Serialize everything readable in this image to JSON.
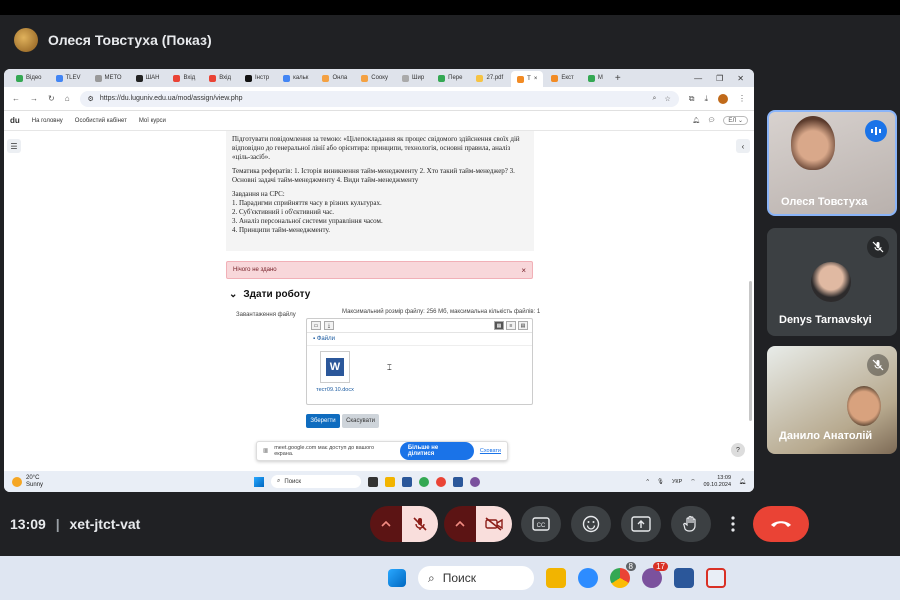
{
  "meet": {
    "presenter_title": "Олеся Товстуха (Показ)",
    "time": "13:09",
    "meeting_code": "xet-jtct-vat"
  },
  "participants": [
    {
      "name": "Олеся Товстуха",
      "state": "speaking"
    },
    {
      "name": "Denys Tarnavskyi",
      "state": "muted"
    },
    {
      "name": "Данило Анатолій",
      "state": "muted"
    }
  ],
  "browser": {
    "tabs": [
      "Відео",
      "TLEV",
      "МЕТО",
      "ШАН",
      "Вхід",
      "Вхід",
      "Інстр",
      "кальк",
      "Онла",
      "Сооку",
      "Шир",
      "Пере",
      "27.pdf",
      "Т",
      "Екст",
      "М"
    ],
    "url": "https://du.luguniv.edu.ua/mod/assign/view.php"
  },
  "site": {
    "logo": "du",
    "nav": [
      "На головну",
      "Особистий кабінет",
      "Мої курси"
    ],
    "user_chip": "ЕЛ"
  },
  "assignment": {
    "desc1": "Підготувати повідомлення за темою: «Цілепокладання як процес свідомого здійснення своїх дій відповідно до генеральної лінії або орієнтира: принципи, технологія, основні правила, аналіз «ціль-засіб».",
    "desc2": "Тематика рефератів: 1. Історія виникнення тайм-менеджменту 2. Хто такий тайм-менеджер? 3. Основні задачі тайм-менеджменту 4. Види тайм-менеджменту",
    "tasks_title": "Завдання на СРС:",
    "tasks": [
      "1. Парадигми сприйняття часу в різних культурах.",
      "2. Суб'єктивний і об'єктивний час.",
      "3. Аналіз персональної системи управління часом.",
      "4. Принципи тайм-менеджменту."
    ],
    "alert_text": "Нічого не здано",
    "section_title": "Здати роботу",
    "upload_label": "Завантаження файлу",
    "max_info": "Максимальний розмір файлу: 256 Мб, максимальна кількість файлів: 1",
    "folder_label": "Файли",
    "file_name": "тест09.10.docx",
    "save_label": "Зберегти",
    "cancel_label": "Скасувати"
  },
  "share_bar": {
    "text": "meet.google.com має доступ до вашого екрана.",
    "stop_label": "Більше не ділитися",
    "hide_label": "Сховати"
  },
  "inner_taskbar": {
    "temp": "20°C",
    "weather": "Sunny",
    "search": "Поиск",
    "lang": "УКР",
    "time": "13:09",
    "date": "09.10.2024"
  },
  "os_taskbar": {
    "search": "Поиск",
    "badge1": "8",
    "badge2": "17"
  },
  "colors": {
    "meet_bg": "#202124",
    "end_call": "#ea4335",
    "speaking": "#1a73e8",
    "mic_off_bg": "#f9dedc",
    "moodle_primary": "#0f6cbf"
  }
}
